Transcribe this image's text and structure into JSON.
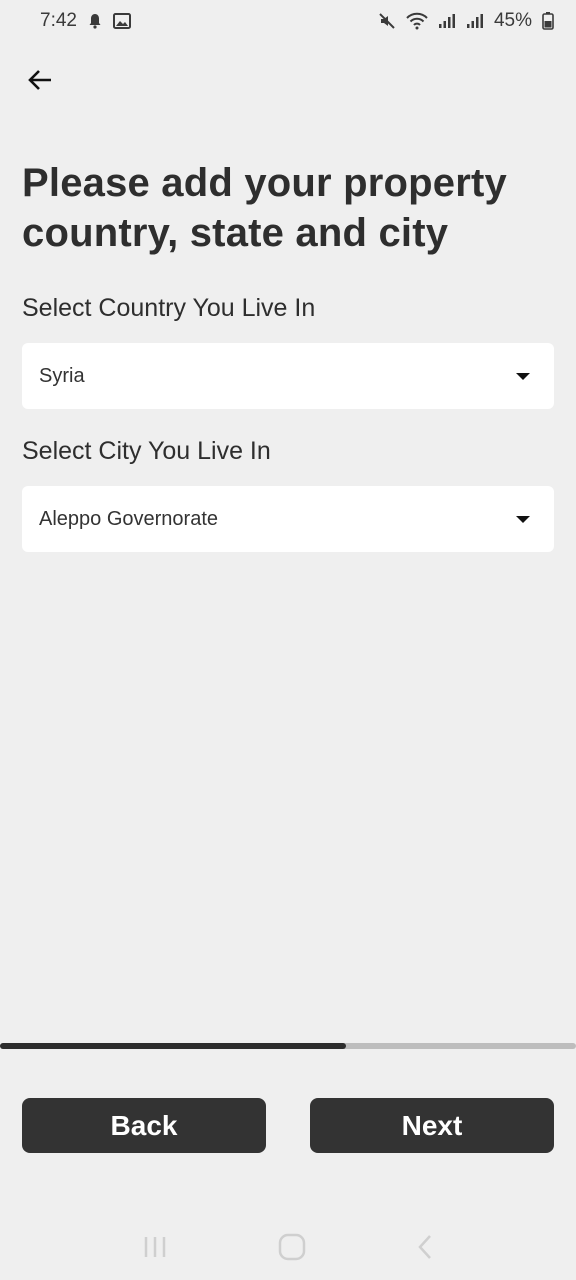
{
  "status_bar": {
    "time": "7:42",
    "battery": "45%",
    "icons": [
      "notification-bell-icon",
      "image-icon",
      "mute-icon",
      "wifi-icon",
      "signal-icon",
      "signal-icon",
      "battery-icon"
    ]
  },
  "header": {
    "back_icon": "back-arrow-icon",
    "title": "Please add your property country, state and city"
  },
  "form": {
    "country": {
      "label": "Select Country You Live In",
      "value": "Syria"
    },
    "city": {
      "label": "Select City You Live In",
      "value": "Aleppo Governorate"
    }
  },
  "progress": {
    "fraction": 0.6
  },
  "footer": {
    "back_label": "Back",
    "next_label": "Next"
  },
  "system_nav": {
    "icons": [
      "recents-icon",
      "home-icon",
      "back-nav-icon"
    ]
  },
  "colors": {
    "background": "#efefef",
    "button": "#333333",
    "progress_fill": "#2d2d2d",
    "progress_track": "#bdbdbd"
  }
}
